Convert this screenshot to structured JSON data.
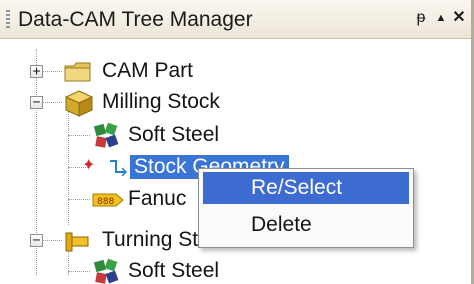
{
  "window": {
    "title": "Data-CAM Tree Manager",
    "pin_glyph": "ᵽ",
    "up_glyph": "▲",
    "close_glyph": "✕"
  },
  "tree": {
    "items": [
      {
        "label": "CAM Part",
        "icon": "folder-icon",
        "expander": "+"
      },
      {
        "label": "Milling Stock",
        "icon": "stock-cube-icon",
        "expander": "−"
      },
      {
        "label": "Soft Steel",
        "icon": "material-icon"
      },
      {
        "label": "Stock Geometry",
        "icon": "geometry-icon",
        "selected": true
      },
      {
        "label": "Fanuc",
        "icon": "machine-icon"
      },
      {
        "label": "Turning St",
        "icon": "turning-stock-icon",
        "expander": "−"
      },
      {
        "label": "Soft Steel",
        "icon": "material-icon"
      }
    ]
  },
  "context_menu": {
    "items": [
      {
        "label": "Re/Select",
        "active": true
      },
      {
        "label": "Delete",
        "active": false
      }
    ]
  }
}
